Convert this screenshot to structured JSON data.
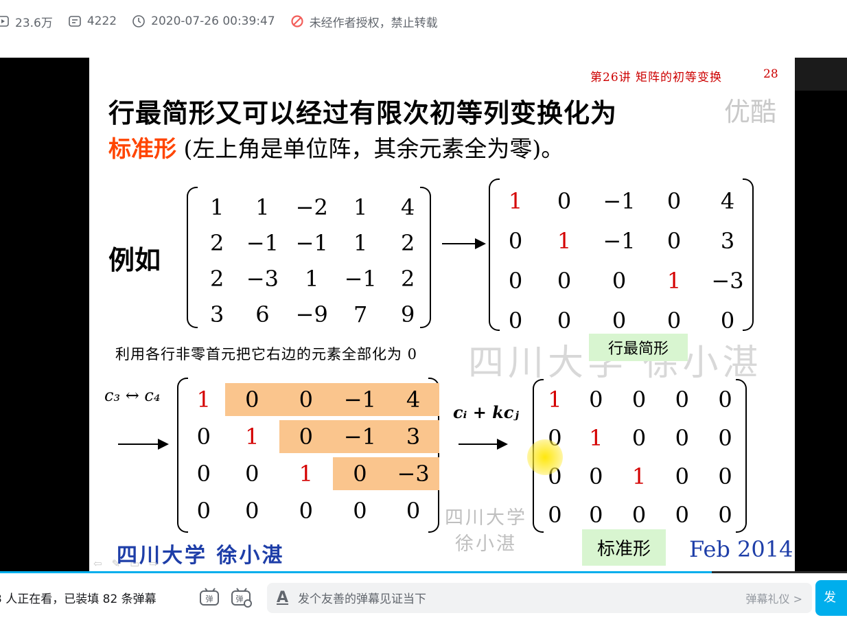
{
  "meta": {
    "views": "23.6万",
    "danmaku_count": "4222",
    "datetime": "2020-07-26 00:39:47",
    "copyright": "未经作者授权，禁止转载"
  },
  "slide": {
    "lecture_title": "第26讲  矩阵的初等变换",
    "page_number": "28",
    "watermark_brand": "优酷",
    "title_line1": "行最简形又可以经过有限次初等列变换化为",
    "title_line2_highlight": "标准形",
    "title_line2_rest": " (左上角是单位阵，其余元素全为零)。",
    "example_label": "例如",
    "note": "利用各行非零首元把它右边的元素全部化为 0",
    "watermark_mid": "四川大学  徐小湛",
    "tag_row_echelon": "行最简形",
    "tag_standard": "标准形",
    "op_swap": "c₃ ↔ c₄",
    "op_elim": "cᵢ + kcⱼ",
    "university_author": "四川大学    徐小湛",
    "watermark_low_1": "四川大学",
    "watermark_low_2": "徐小湛",
    "date": "Feb 2014",
    "matrix_A": [
      [
        "1",
        "1",
        "−2",
        "1",
        "4"
      ],
      [
        "2",
        "−1",
        "−1",
        "1",
        "2"
      ],
      [
        "2",
        "−3",
        "1",
        "−1",
        "2"
      ],
      [
        "3",
        "6",
        "−9",
        "7",
        "9"
      ]
    ],
    "matrix_R": [
      [
        "1",
        "0",
        "−1",
        "0",
        "4"
      ],
      [
        "0",
        "1",
        "−1",
        "0",
        "3"
      ],
      [
        "0",
        "0",
        "0",
        "1",
        "−3"
      ],
      [
        "0",
        "0",
        "0",
        "0",
        "0"
      ]
    ],
    "matrix_S": [
      [
        "1",
        "0",
        "0",
        "−1",
        "4"
      ],
      [
        "0",
        "1",
        "0",
        "−1",
        "3"
      ],
      [
        "0",
        "0",
        "1",
        "0",
        "−3"
      ],
      [
        "0",
        "0",
        "0",
        "0",
        "0"
      ]
    ],
    "matrix_I": [
      [
        "1",
        "0",
        "0",
        "0",
        "0"
      ],
      [
        "0",
        "1",
        "0",
        "0",
        "0"
      ],
      [
        "0",
        "0",
        "1",
        "0",
        "0"
      ],
      [
        "0",
        "0",
        "0",
        "0",
        "0"
      ]
    ]
  },
  "player": {
    "progress_fraction": 0.84
  },
  "bottom": {
    "viewers_text": "3 人正在看，已装填 82 条弹幕",
    "input_placeholder": "发个友善的弹幕见证当下",
    "etiquette": "弹幕礼仪 >",
    "send_label": "发"
  }
}
